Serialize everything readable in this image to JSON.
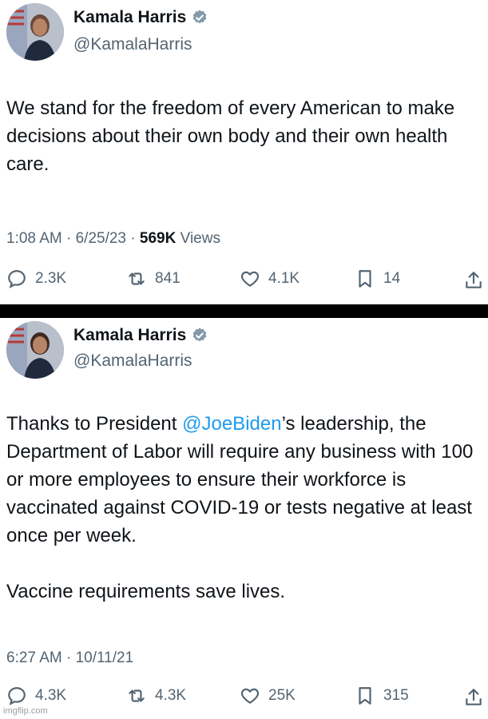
{
  "tweets": [
    {
      "author_name": "Kamala Harris",
      "handle": "@KamalaHarris",
      "text": "We stand for the freedom of every American to make decisions about their own body and their own health care.",
      "time": "1:08 AM",
      "date": "6/25/23",
      "views_count": "569K",
      "views_label": "Views",
      "replies": "2.3K",
      "reposts": "841",
      "likes": "4.1K",
      "bookmarks": "14"
    },
    {
      "author_name": "Kamala Harris",
      "handle": "@KamalaHarris",
      "text_before": "Thanks to President ",
      "mention": "@JoeBiden",
      "text_after": "’s leadership, the Department of Labor will require any business with 100 or more employees to ensure their workforce is vaccinated against COVID-19 or tests negative at least once per week.",
      "text_para2": "Vaccine requirements save lives.",
      "time": "6:27 AM",
      "date": "10/11/21",
      "replies": "4.3K",
      "reposts": "4.3K",
      "likes": "25K",
      "bookmarks": "315"
    }
  ],
  "watermark": "imgflip.com",
  "colors": {
    "text": "#0f1419",
    "secondary": "#536471",
    "link": "#1d9bf0",
    "divider": "#000000"
  },
  "icons": [
    "verified-badge-icon",
    "reply-icon",
    "repost-icon",
    "like-icon",
    "bookmark-icon",
    "share-icon"
  ]
}
